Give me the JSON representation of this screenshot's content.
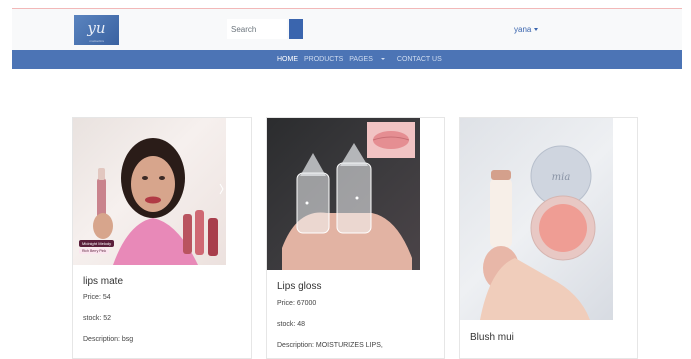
{
  "header": {
    "logo_text": "yu",
    "logo_sub": "cosmetics",
    "search_placeholder": "Search",
    "user_name": "yana"
  },
  "nav": {
    "items": [
      {
        "label": "HOME",
        "active": true
      },
      {
        "label": "PRODUCTS",
        "active": false
      },
      {
        "label": "PAGES",
        "active": false,
        "dropdown": true
      },
      {
        "label": "CONTACT US",
        "active": false
      }
    ]
  },
  "products": [
    {
      "title": "lips mate",
      "price": "Price: 54",
      "stock": "stock: 52",
      "description": "Description: bsg",
      "image_label_1": "Midnight Melody",
      "image_label_2": "Rich Berry Pink"
    },
    {
      "title": "Lips gloss",
      "price": "Price: 67000",
      "stock": "stock: 48",
      "description": "Description: MOISTURIZES LIPS,"
    },
    {
      "title": "Blush mui",
      "image_label_1": "mia"
    }
  ],
  "colors": {
    "navbar": "#4c74b5",
    "topbar": "#f8f9fa",
    "accent": "#3a65ae"
  }
}
